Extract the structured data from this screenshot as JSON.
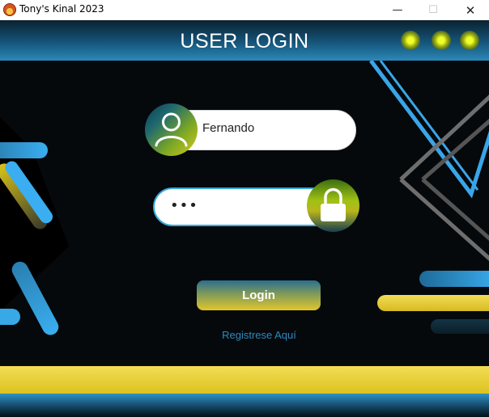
{
  "window": {
    "title": "Tony's Kinal 2023",
    "icon": "app-logo-icon",
    "controls": {
      "minimize": "—",
      "maximize": "☐",
      "close": "✕"
    }
  },
  "header": {
    "title": "USER LOGIN",
    "dots": [
      "yellow-dot",
      "yellow-dot",
      "yellow-dot"
    ]
  },
  "form": {
    "username": {
      "value": "Fernando",
      "icon": "user-icon"
    },
    "password": {
      "value": "•••",
      "icon": "lock-icon"
    },
    "login_label": "Login",
    "register_label": "Registrese Aquí"
  },
  "colors": {
    "accent_blue": "#37a9dc",
    "accent_yellow": "#e2c62d",
    "background": "#05090c"
  }
}
